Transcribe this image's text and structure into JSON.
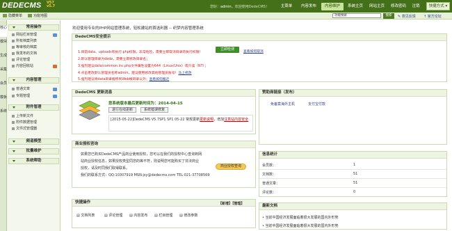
{
  "header": {
    "logo": "DEDECMS",
    "version_top": "V57",
    "version_bottom": "v5.7",
    "welcome_prefix": "您好：",
    "username": "admin",
    "welcome_suffix": "，欢迎使用DedeCMS！",
    "nav": [
      "主菜单",
      "内容发布",
      "内容维护",
      "系统主页",
      "网站主页",
      "修改密码",
      "注销"
    ],
    "quick_button": "快捷方式 ▾"
  },
  "subbar": {
    "hide_menu": "隐藏菜单",
    "map": "功能地图",
    "search_placeholder": "功能搜索",
    "search_button": "搜索",
    "feedback": "意见反馈",
    "forum": "官方论坛"
  },
  "side_tabs": [
    "核心",
    "模块",
    "生成",
    "采集",
    "会员",
    "模板",
    "系统"
  ],
  "menu": {
    "sections": [
      {
        "title": "常用操作",
        "items": [
          "网站栏目管理",
          "所有档案列表",
          "等审核的档案",
          "我发布的文档",
          "评论管理",
          "内容回收站"
        ]
      },
      {
        "title": "内容管理",
        "items": [
          "普通文章",
          "专题管理"
        ]
      },
      {
        "title": "附件管理",
        "items": [
          "上传新文件",
          "附件数据管理",
          "文件式管理器"
        ]
      },
      {
        "title": "频道模型",
        "items": []
      },
      {
        "title": "批量维护",
        "items": []
      },
      {
        "title": "系统帮助",
        "items": []
      }
    ]
  },
  "main": {
    "page_title": "欢迎使用专业的PHP网站管理系统，轻松建站的首选利器 -- 织梦内容管理系统",
    "security": {
      "title": "DedeCMS安全提示",
      "lines": [
        {
          "prefix": "1.目前data、uploads有执行.php权限，非常危险，需要立即取消目录的执行权限！",
          "link": ""
        },
        {
          "prefix": "2.默认管理目录为dede，需要立即修改目录名；",
          "link": ""
        },
        {
          "prefix": "3.强烈建议data/common.inc.php文件属性设置为644（Linux/Unix）或只读（NT）；",
          "link": ""
        },
        {
          "prefix": "4.点击更改默认管理员名称admin，建议使用修改其他管理员账号！",
          "link": "马上修改"
        },
        {
          "prefix": "5.强烈建议将data目录搬移到Web根目录以外；",
          "link": "查看如何搬迁"
        }
      ],
      "detect_button": "立即检测",
      "cancel_link": "查看如何取消"
    },
    "update": {
      "title": "DedeCMS 更新消息",
      "status_line": "您系统版本最后更新时间为：2014-04-15",
      "update_button": "进行在线更新",
      "mode_button": "系统错误修复",
      "news_prefix": "[2015-05-22]DedeCMS V5.7SP1 SP1 05-22 常规更新",
      "news_link": "更新说明",
      "news_suffix": "，增加",
      "news_link2": "注意站内容安全"
    },
    "license": {
      "title": "商业授权咨询",
      "body": [
        "如果您已购买DedeCMS产品商业使用授权，您可以在我们的授权中心查询到网",
        "站商业授权信息，如果授权类型同您的等不符，则说明您可能购买了非法商业",
        "授权，请及时同我们取得联系。",
        "我们的联系方式：QQ:10307919 MSN:jsy@dedecms.com TEL:021-37708569"
      ],
      "button": "商业授权查询"
    },
    "quick_ops": {
      "title": "快捷操作",
      "actions": "【新增】【管理】",
      "items": [
        "文档列表",
        "评论管理",
        "内容发布",
        "栏目管理",
        "修改参数"
      ]
    },
    "sponsor": {
      "title": "赞助商链接（发布）",
      "links": [
        "免备案海外主机",
        "支付宝付款"
      ]
    },
    "stats": {
      "title": "信息统计",
      "rows": [
        {
          "label": "会员数：",
          "value": "1"
        },
        {
          "label": "文档数：",
          "value": "51"
        },
        {
          "label": "普通文章：",
          "value": "51"
        },
        {
          "label": "评论数：",
          "value": "0"
        }
      ]
    },
    "latest": {
      "title": "最新文档",
      "items": [
        "• 当前中国经济发展面临着很大发展的国内外形势",
        "• 当前中国经济发展面临着很大发展的国内外形势"
      ]
    }
  }
}
